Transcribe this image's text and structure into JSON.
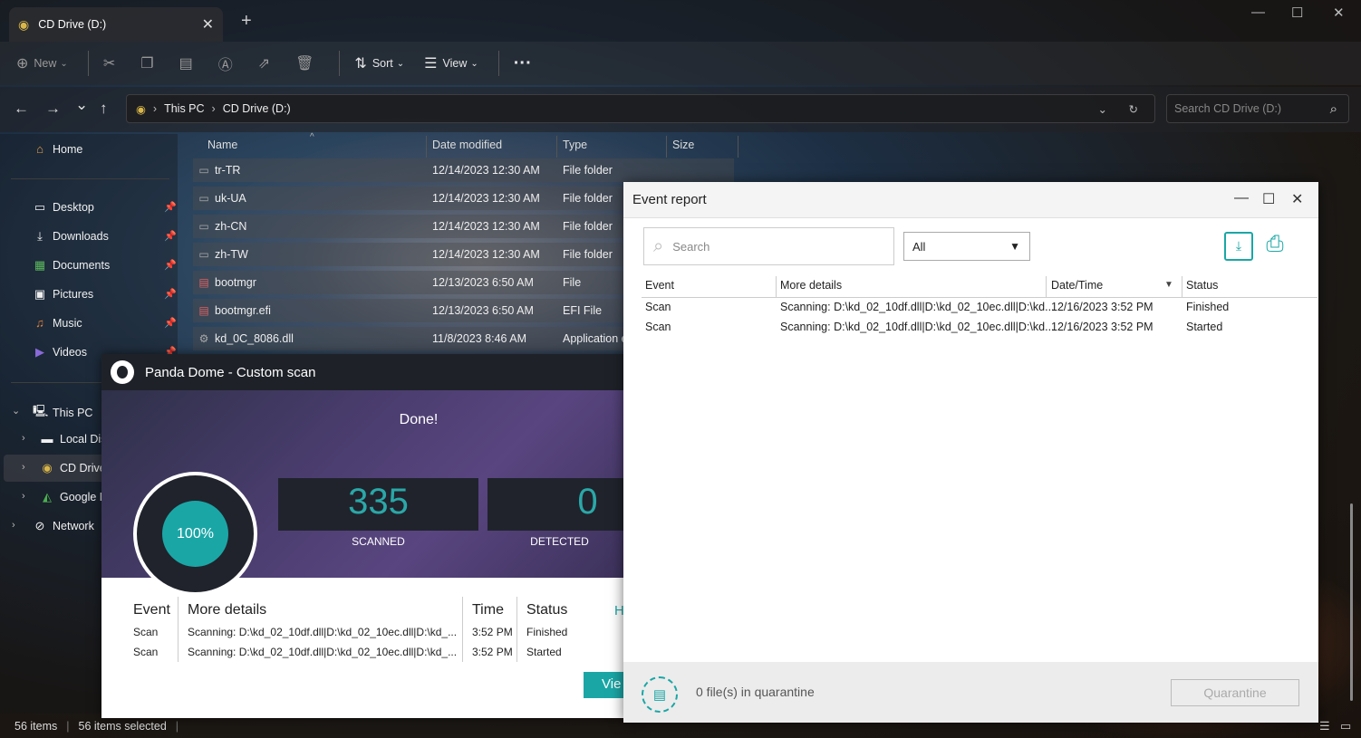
{
  "explorer": {
    "tab_title": "CD Drive (D:)",
    "tab_close": "✕",
    "new_tab": "+",
    "window_controls": {
      "minimize": "—",
      "maximize": "☐",
      "close": "✕"
    },
    "toolbar": {
      "new_label": "New",
      "sort_label": "Sort",
      "view_label": "View",
      "more_label": "···"
    },
    "nav": {
      "back": "←",
      "forward": "→",
      "recent": "⌄",
      "up": "↑"
    },
    "breadcrumb": [
      "This PC",
      "CD Drive (D:)"
    ],
    "search_placeholder": "Search CD Drive (D:)",
    "sidebar": {
      "home": "Home",
      "pinned": [
        "Desktop",
        "Downloads",
        "Documents",
        "Pictures",
        "Music",
        "Videos"
      ],
      "tree": [
        "This PC",
        "Local Dis",
        "CD Drive",
        "Google D",
        "Network"
      ]
    },
    "columns": [
      "Name",
      "Date modified",
      "Type",
      "Size"
    ],
    "files": [
      {
        "name": "tr-TR",
        "date": "12/14/2023 12:30 AM",
        "type": "File folder",
        "icon": "folder-icon"
      },
      {
        "name": "uk-UA",
        "date": "12/14/2023 12:30 AM",
        "type": "File folder",
        "icon": "folder-icon"
      },
      {
        "name": "zh-CN",
        "date": "12/14/2023 12:30 AM",
        "type": "File folder",
        "icon": "folder-icon"
      },
      {
        "name": "zh-TW",
        "date": "12/14/2023 12:30 AM",
        "type": "File folder",
        "icon": "folder-icon"
      },
      {
        "name": "bootmgr",
        "date": "12/13/2023 6:50 AM",
        "type": "File",
        "icon": "file-icon"
      },
      {
        "name": "bootmgr.efi",
        "date": "12/13/2023 6:50 AM",
        "type": "EFI File",
        "icon": "file-icon"
      },
      {
        "name": "kd_0C_8086.dll",
        "date": "11/8/2023 8:46 AM",
        "type": "Application e",
        "icon": "gear-file-icon"
      }
    ],
    "status_items": "56 items",
    "status_selected": "56 items selected"
  },
  "panda": {
    "title": "Panda Dome - Custom scan",
    "done": "Done!",
    "progress": "100%",
    "scanned_value": "335",
    "scanned_label": "SCANNED",
    "detected_value": "0",
    "detected_label": "DETECTED",
    "headers": [
      "Event",
      "More details",
      "Time",
      "Status"
    ],
    "rows": [
      {
        "event": "Scan",
        "details": "Scanning: D:\\kd_02_10df.dll|D:\\kd_02_10ec.dll|D:\\kd_...",
        "time": "3:52 PM",
        "status": "Finished"
      },
      {
        "event": "Scan",
        "details": "Scanning: D:\\kd_02_10df.dll|D:\\kd_02_10ec.dll|D:\\kd_...",
        "time": "3:52 PM",
        "status": "Started"
      }
    ],
    "help_partial": "H",
    "view_partial": "Vie"
  },
  "event_report": {
    "title": "Event report",
    "search_placeholder": "Search",
    "filter_value": "All",
    "headers": [
      "Event",
      "More details",
      "Date/Time",
      "Status"
    ],
    "rows": [
      {
        "event": "Scan",
        "details": "Scanning: D:\\kd_02_10df.dll|D:\\kd_02_10ec.dll|D:\\kd...",
        "datetime": "12/16/2023 3:52 PM",
        "status": "Finished"
      },
      {
        "event": "Scan",
        "details": "Scanning: D:\\kd_02_10df.dll|D:\\kd_02_10ec.dll|D:\\kd...",
        "datetime": "12/16/2023 3:52 PM",
        "status": "Started"
      }
    ],
    "quarantine_text": "0 file(s) in quarantine",
    "quarantine_button": "Quarantine"
  },
  "colors": {
    "accent": "#1ba6a6",
    "panda_dark": "#1e2228",
    "explorer_blue": "#5b9ee8"
  }
}
